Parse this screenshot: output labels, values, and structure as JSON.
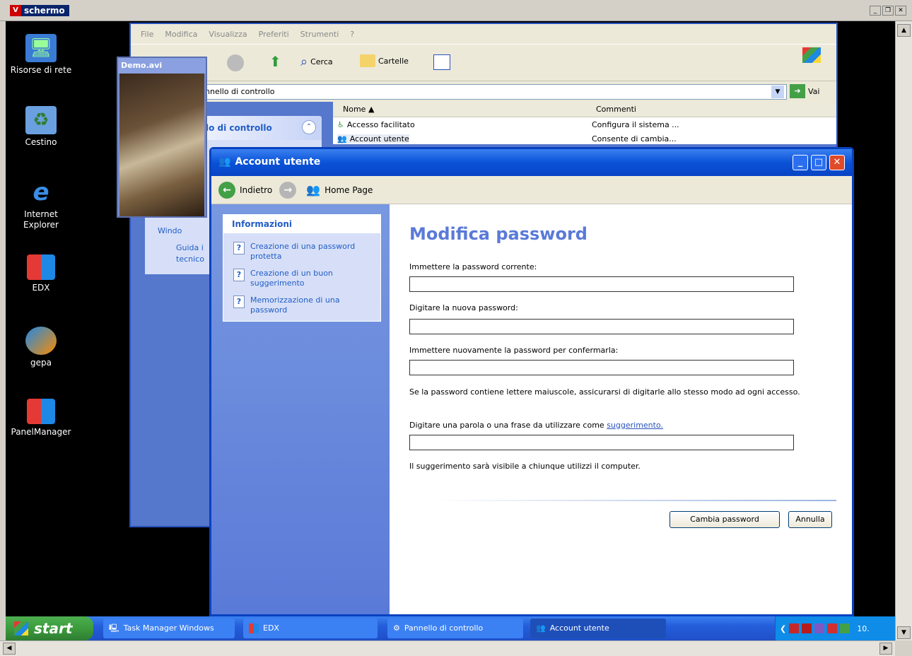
{
  "outer": {
    "title": "schermo",
    "vicon": "V"
  },
  "desktop_icons": [
    {
      "label": "Risorse di rete"
    },
    {
      "label": "Cestino"
    },
    {
      "label": "Internet Explorer"
    },
    {
      "label": "EDX"
    },
    {
      "label": "gepa"
    },
    {
      "label": "PanelManager"
    }
  ],
  "control_panel": {
    "menu": [
      "File",
      "Modifica",
      "Visualizza",
      "Preferiti",
      "Strumenti",
      "?"
    ],
    "toolbar": {
      "search": "Cerca",
      "folders": "Cartelle"
    },
    "address": "nnello di controllo",
    "go_label": "Vai",
    "sidebar_title": "lo di controllo",
    "sidebar_links": [
      "Windo",
      "Guida i",
      "tecnico"
    ],
    "columns": {
      "name": "Nome",
      "comments": "Commenti"
    },
    "rows": [
      {
        "name": "Accesso facilitato",
        "comment": "Configura il sistema ..."
      },
      {
        "name": "Account utente",
        "comment": "Consente di cambia..."
      }
    ]
  },
  "demo": {
    "title": "Demo.avi"
  },
  "dialog": {
    "title": "Account utente",
    "nav": {
      "back": "Indietro",
      "home": "Home Page"
    },
    "info": {
      "heading": "Informazioni",
      "items": [
        "Creazione di una password protetta",
        "Creazione di un buon suggerimento",
        "Memorizzazione di una password"
      ]
    },
    "main": {
      "heading": "Modifica password",
      "current_label": "Immettere la password corrente:",
      "new_label": "Digitare la nuova password:",
      "confirm_label": "Immettere nuovamente la password per confermarla:",
      "case_note": "Se la password contiene lettere maiuscole, assicurarsi di digitarle allo stesso modo ad ogni accesso.",
      "hint_label_prefix": "Digitare una parola o una frase da utilizzare come ",
      "hint_link": "suggerimento.",
      "hint_note": "Il suggerimento sarà visibile a chiunque utilizzi il computer.",
      "change_button": "Cambia password",
      "cancel_button": "Annulla"
    }
  },
  "taskbar": {
    "start": "start",
    "tasks": [
      "Task Manager Windows",
      "EDX",
      "Pannello di controllo",
      "Account utente"
    ],
    "clock": "10."
  }
}
